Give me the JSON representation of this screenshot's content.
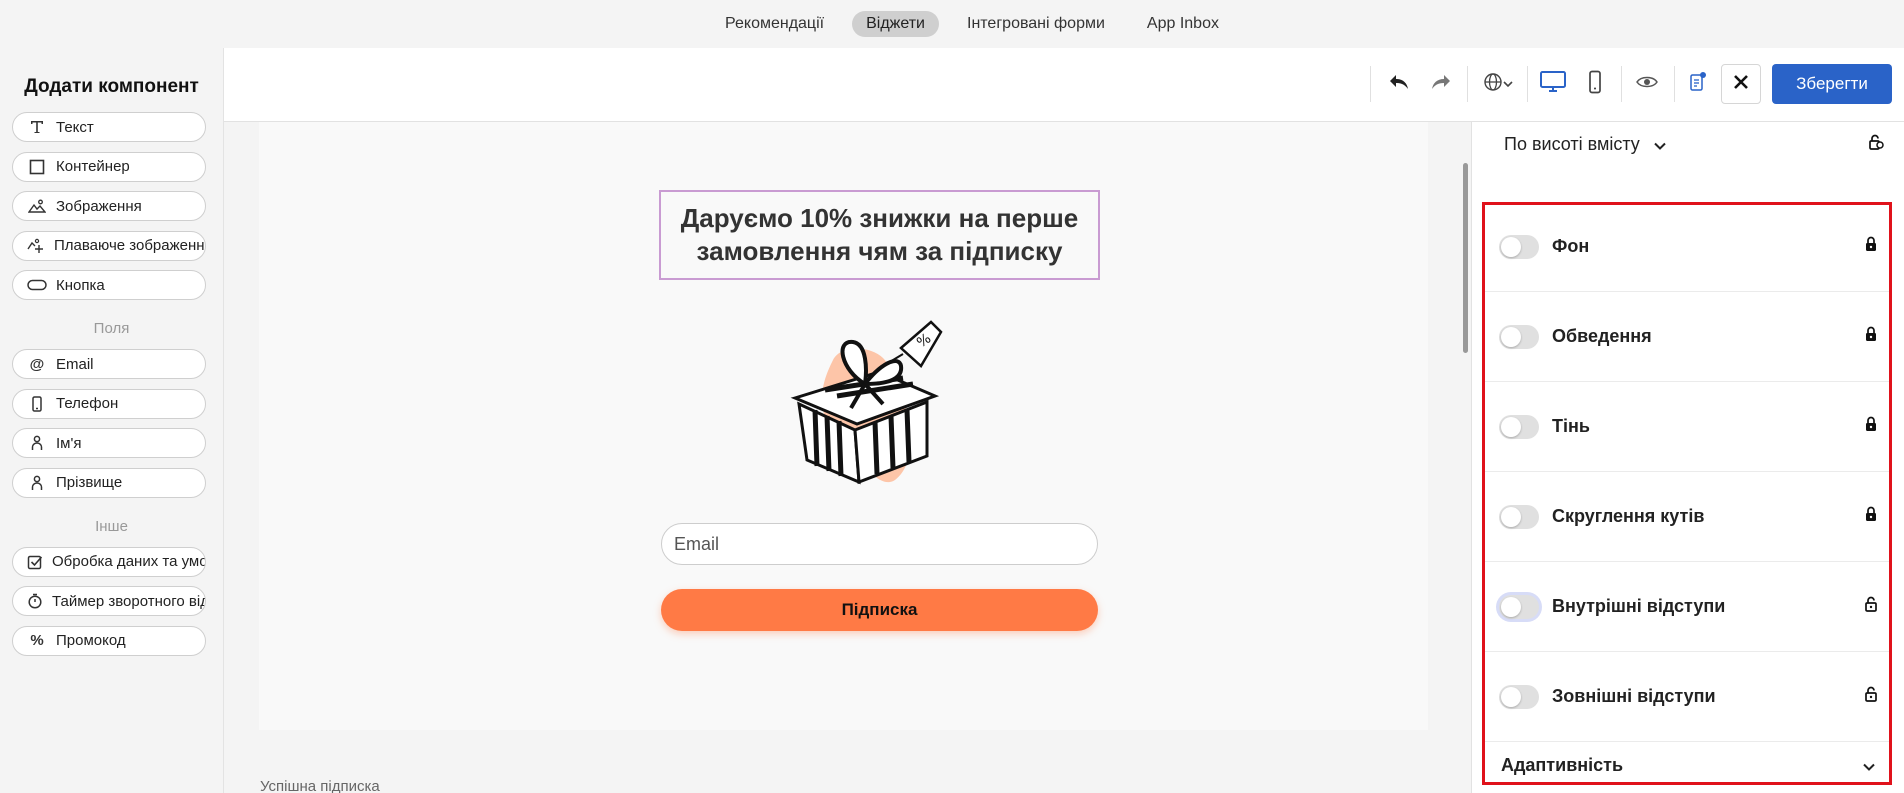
{
  "top_nav": {
    "tabs": [
      {
        "label": "Рекомендації",
        "active": false
      },
      {
        "label": "Віджети",
        "active": true
      },
      {
        "label": "Інтегровані форми",
        "active": false
      },
      {
        "label": "App Inbox",
        "active": false
      }
    ]
  },
  "sidebar": {
    "title": "Додати компонент",
    "components": [
      {
        "icon": "text-icon",
        "label": "Текст"
      },
      {
        "icon": "container-icon",
        "label": "Контейнер"
      },
      {
        "icon": "image-icon",
        "label": "Зображення"
      },
      {
        "icon": "floating-image-icon",
        "label": "Плаваюче зображення"
      },
      {
        "icon": "button-shape-icon",
        "label": "Кнопка"
      }
    ],
    "fields_label": "Поля",
    "fields": [
      {
        "icon": "at-icon",
        "label": "Email"
      },
      {
        "icon": "phone-icon",
        "label": "Телефон"
      },
      {
        "icon": "person-icon",
        "label": "Ім'я"
      },
      {
        "icon": "person-icon",
        "label": "Прізвище"
      }
    ],
    "other_label": "Інше",
    "other": [
      {
        "icon": "checkbox-icon",
        "label": "Обробка даних та умови"
      },
      {
        "icon": "timer-icon",
        "label": "Таймер зворотного відліку"
      },
      {
        "icon": "percent-icon",
        "label": "Промокод"
      }
    ]
  },
  "toolbar": {
    "save_label": "Зберегти",
    "accent": "#2a63c8"
  },
  "canvas": {
    "headline": "Даруємо 10% знижки на перше замовлення чям за підписку",
    "email_placeholder": "Email",
    "subscribe_label": "Підписка",
    "success_label": "Успішна підписка",
    "button_color": "#ff7a45"
  },
  "panel": {
    "height_mode": "По висоті вмісту",
    "properties": [
      {
        "label": "Фон",
        "enabled": false,
        "locked": true
      },
      {
        "label": "Обведення",
        "enabled": false,
        "locked": true
      },
      {
        "label": "Тінь",
        "enabled": false,
        "locked": true
      },
      {
        "label": "Скруглення кутів",
        "enabled": false,
        "locked": true
      },
      {
        "label": "Внутрішні відступи",
        "enabled": false,
        "locked": false
      },
      {
        "label": "Зовнішні відступи",
        "enabled": false,
        "locked": false
      }
    ],
    "adaptivity_label": "Адаптивність",
    "highlight_color": "#e0121b"
  }
}
